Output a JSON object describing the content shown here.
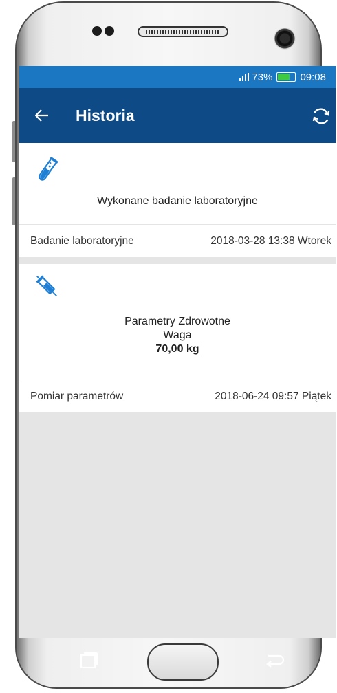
{
  "status_bar": {
    "battery_percent": "73%",
    "time": "09:08",
    "battery_level": 0.73
  },
  "app_bar": {
    "title": "Historia",
    "back_icon": "arrow-left-icon",
    "refresh_icon": "refresh-icon"
  },
  "history": [
    {
      "icon": "test-tube-icon",
      "description": "Wykonane badanie laboratoryjne",
      "category": "Badanie laboratoryjne",
      "datetime": "2018-03-28 13:38 Wtorek"
    },
    {
      "icon": "syringe-icon",
      "title": "Parametry Zdrowotne",
      "subtitle": "Waga",
      "value": "70,00 kg",
      "category": "Pomiar parametrów",
      "datetime": "2018-06-24 09:57 Piątek"
    }
  ],
  "colors": {
    "status_bar": "#1c77c3",
    "app_bar": "#0e4b86",
    "icon_blue": "#1e7fd4",
    "background": "#e5e5e5"
  }
}
